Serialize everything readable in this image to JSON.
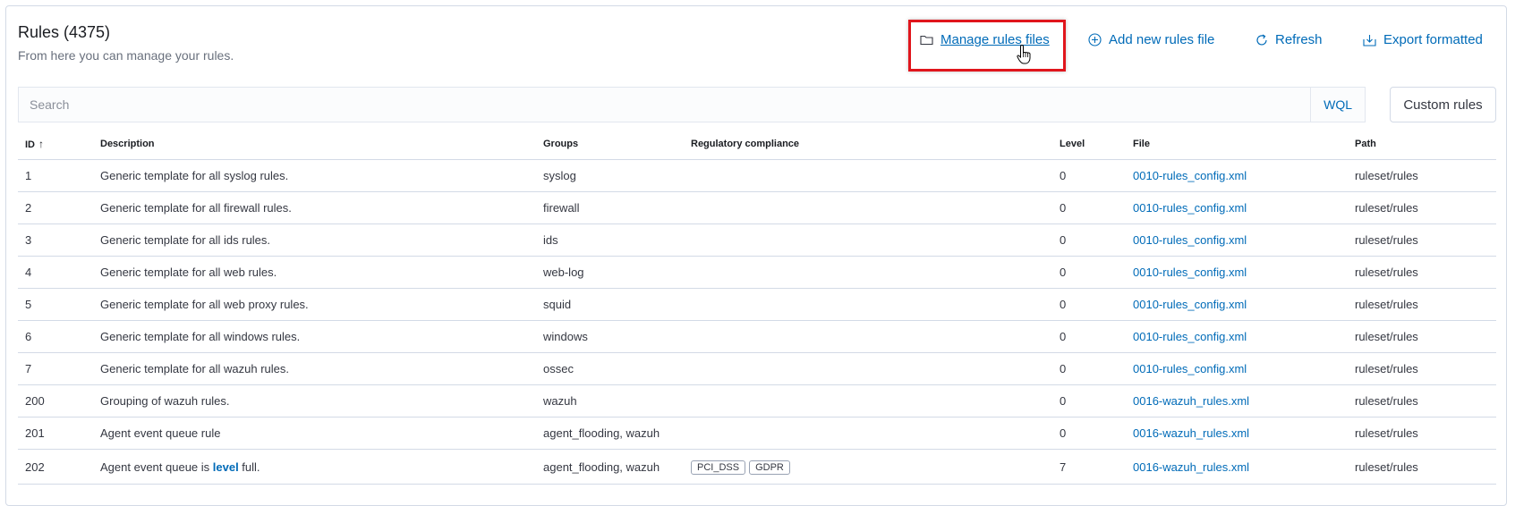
{
  "header": {
    "title": "Rules (4375)",
    "subtitle": "From here you can manage your rules."
  },
  "actions": {
    "manage": "Manage rules files",
    "add": "Add new rules file",
    "refresh": "Refresh",
    "export": "Export formatted"
  },
  "search": {
    "placeholder": "Search",
    "wql": "WQL",
    "custom_rules": "Custom rules"
  },
  "table": {
    "columns": {
      "id": "ID",
      "description": "Description",
      "groups": "Groups",
      "compliance": "Regulatory compliance",
      "level": "Level",
      "file": "File",
      "path": "Path"
    },
    "rows": [
      {
        "id": "1",
        "description": "Generic template for all syslog rules.",
        "groups": "syslog",
        "level": "0",
        "file": "0010-rules_config.xml",
        "path": "ruleset/rules"
      },
      {
        "id": "2",
        "description": "Generic template for all firewall rules.",
        "groups": "firewall",
        "level": "0",
        "file": "0010-rules_config.xml",
        "path": "ruleset/rules"
      },
      {
        "id": "3",
        "description": "Generic template for all ids rules.",
        "groups": "ids",
        "level": "0",
        "file": "0010-rules_config.xml",
        "path": "ruleset/rules"
      },
      {
        "id": "4",
        "description": "Generic template for all web rules.",
        "groups": "web-log",
        "level": "0",
        "file": "0010-rules_config.xml",
        "path": "ruleset/rules"
      },
      {
        "id": "5",
        "description": "Generic template for all web proxy rules.",
        "groups": "squid",
        "level": "0",
        "file": "0010-rules_config.xml",
        "path": "ruleset/rules"
      },
      {
        "id": "6",
        "description": "Generic template for all windows rules.",
        "groups": "windows",
        "level": "0",
        "file": "0010-rules_config.xml",
        "path": "ruleset/rules"
      },
      {
        "id": "7",
        "description": "Generic template for all wazuh rules.",
        "groups": "ossec",
        "level": "0",
        "file": "0010-rules_config.xml",
        "path": "ruleset/rules"
      },
      {
        "id": "200",
        "description": "Grouping of wazuh rules.",
        "groups": "wazuh",
        "level": "0",
        "file": "0016-wazuh_rules.xml",
        "path": "ruleset/rules"
      },
      {
        "id": "201",
        "description": "Agent event queue rule",
        "groups": "agent_flooding, wazuh",
        "level": "0",
        "file": "0016-wazuh_rules.xml",
        "path": "ruleset/rules"
      }
    ],
    "last_row": {
      "id": "202",
      "description_pre": "Agent event queue is ",
      "description_kw": "level",
      "description_post": " full.",
      "groups": "agent_flooding, wazuh",
      "badges": [
        "PCI_DSS",
        "GDPR"
      ],
      "level": "7",
      "file": "0016-wazuh_rules.xml",
      "path": "ruleset/rules"
    }
  },
  "colors": {
    "link": "#006bb8",
    "highlight": "#e0151c"
  }
}
